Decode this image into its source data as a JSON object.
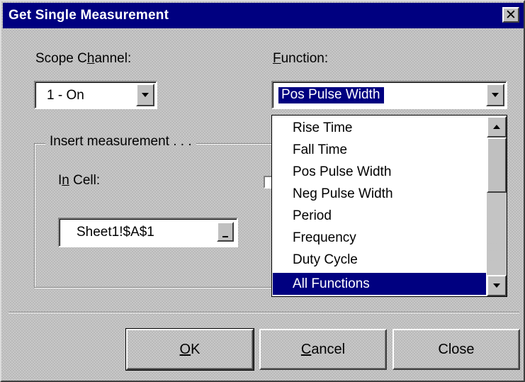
{
  "dialog": {
    "title": "Get Single Measurement",
    "close_glyph": "✕"
  },
  "scope_channel": {
    "label_prefix": "Scope C",
    "label_accel": "h",
    "label_suffix": "annel:",
    "value": "1 - On"
  },
  "function": {
    "label_accel": "F",
    "label_suffix": "unction:",
    "value": "Pos Pulse Width",
    "options": [
      "Rise Time",
      "Fall Time",
      "Pos Pulse Width",
      "Neg Pulse Width",
      "Period",
      "Frequency",
      "Duty Cycle",
      "All Functions"
    ],
    "highlighted_option": "All Functions"
  },
  "insert_group": {
    "legend": "Insert measurement . . .",
    "cell_label_prefix": "I",
    "cell_label_accel": "n",
    "cell_label_suffix": " Cell:",
    "cell_value": "Sheet1!$A$1"
  },
  "buttons": {
    "ok_accel": "O",
    "ok_suffix": "K",
    "cancel_accel": "C",
    "cancel_suffix": "ancel",
    "close": "Close"
  },
  "colors": {
    "titlebar": "#000080",
    "selection": "#000080",
    "face": "#c0c0c0"
  }
}
